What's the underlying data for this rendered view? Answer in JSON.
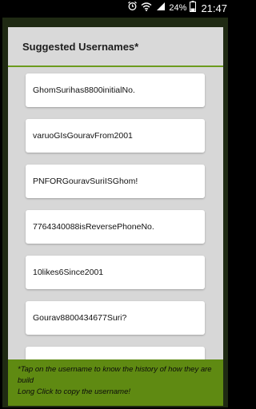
{
  "status_bar": {
    "battery_percent": "24%",
    "time": "21:47",
    "icons": [
      "alarm-icon",
      "wifi-icon",
      "signal-icon",
      "battery-icon"
    ]
  },
  "dialog": {
    "title": "Suggested Usernames*",
    "items": [
      "GhomSurihas8800initialNo.",
      "varuoGIsGouravFrom2001",
      "PNFORGouravSuriISGhom!",
      "7764340088isReversePhoneNo.",
      "10likes6Since2001",
      "Gourav8800434677Suri?",
      ""
    ],
    "footer_line1": "*Tap on the username to know the history of how they are build",
    "footer_line2": "Long Click to copy the username!"
  },
  "colors": {
    "accent": "#6c9b1d",
    "footer_bg": "#5f8a12",
    "frame": "#1f2a13",
    "panel_bg": "#d7d7d7"
  }
}
